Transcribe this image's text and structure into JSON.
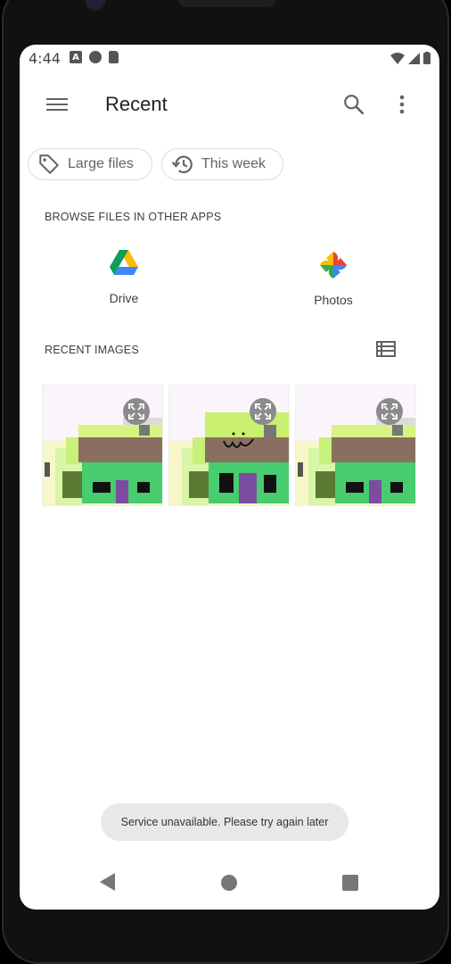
{
  "status_bar": {
    "time": "4:44",
    "icon_a": "A"
  },
  "app_bar": {
    "title": "Recent"
  },
  "chips": [
    {
      "label": "Large files",
      "icon": "tag-icon"
    },
    {
      "label": "This week",
      "icon": "history-icon"
    }
  ],
  "browse": {
    "heading": "BROWSE FILES IN OTHER APPS",
    "apps": [
      {
        "label": "Drive",
        "icon": "drive-icon"
      },
      {
        "label": "Photos",
        "icon": "photos-icon"
      }
    ]
  },
  "recent_images": {
    "heading": "RECENT IMAGES"
  },
  "toast": {
    "message": "Service unavailable. Please try again later"
  }
}
